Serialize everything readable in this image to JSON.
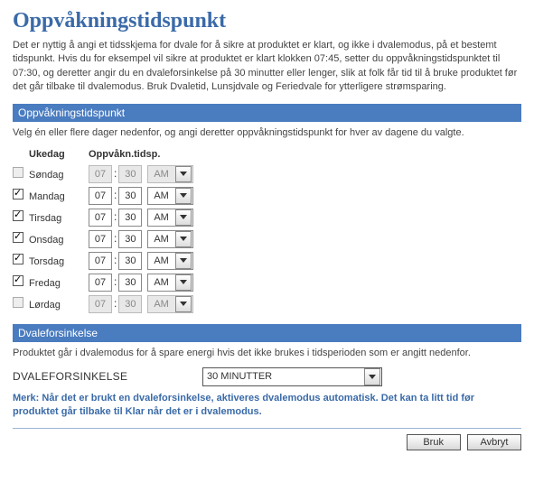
{
  "page": {
    "title": "Oppvåkningstidspunkt",
    "intro": "Det er nyttig å angi et tidsskjema for dvale for å sikre at produktet er klart, og ikke i dvalemodus, på et bestemt tidspunkt. Hvis du for eksempel vil sikre at produktet er klart klokken 07:45, setter du oppvåkningstidspunktet til 07:30, og deretter angir du en dvaleforsinkelse på 30 minutter eller lenger, slik at folk får tid til å bruke produktet før det går tilbake til dvalemodus. Bruk Dvaletid, Lunsjdvale og Feriedvale for ytterligere strømsparing."
  },
  "wake": {
    "bar": "Oppvåkningstidspunkt",
    "desc": "Velg én eller flere dager nedenfor, og angi deretter oppvåkningstidspunkt for hver av dagene du valgte.",
    "col_day": "Ukedag",
    "col_time": "Oppvåkn.tidsp.",
    "days": [
      {
        "name": "Søndag",
        "checked": false,
        "enabled": false,
        "hh": "07",
        "mm": "30",
        "ampm": "AM"
      },
      {
        "name": "Mandag",
        "checked": true,
        "enabled": true,
        "hh": "07",
        "mm": "30",
        "ampm": "AM"
      },
      {
        "name": "Tirsdag",
        "checked": true,
        "enabled": true,
        "hh": "07",
        "mm": "30",
        "ampm": "AM"
      },
      {
        "name": "Onsdag",
        "checked": true,
        "enabled": true,
        "hh": "07",
        "mm": "30",
        "ampm": "AM"
      },
      {
        "name": "Torsdag",
        "checked": true,
        "enabled": true,
        "hh": "07",
        "mm": "30",
        "ampm": "AM"
      },
      {
        "name": "Fredag",
        "checked": true,
        "enabled": true,
        "hh": "07",
        "mm": "30",
        "ampm": "AM"
      },
      {
        "name": "Lørdag",
        "checked": false,
        "enabled": false,
        "hh": "07",
        "mm": "30",
        "ampm": "AM"
      }
    ]
  },
  "sleep": {
    "bar": "Dvaleforsinkelse",
    "desc": "Produktet går i dvalemodus for å spare energi hvis det ikke brukes i tidsperioden som er angitt nedenfor.",
    "label": "DVALEFORSINKELSE",
    "value": "30 MINUTTER",
    "note": "Merk: Når det er brukt en dvaleforsinkelse, aktiveres dvalemodus automatisk. Det kan ta litt tid før produktet går tilbake til Klar når det er i dvalemodus."
  },
  "buttons": {
    "apply": "Bruk",
    "cancel": "Avbryt"
  }
}
